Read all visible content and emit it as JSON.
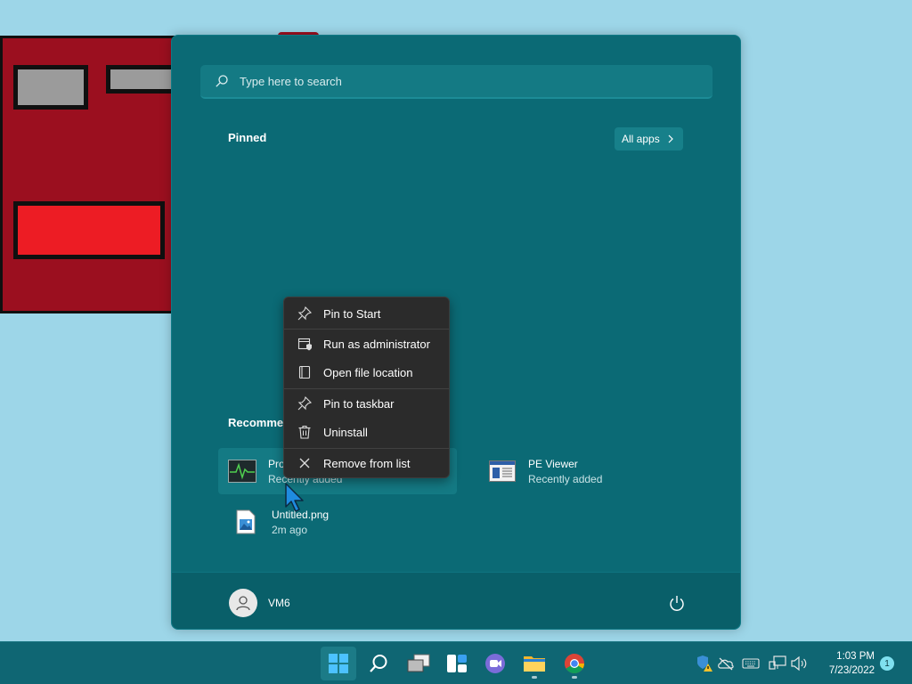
{
  "start_menu": {
    "search": {
      "placeholder": "Type here to search"
    },
    "pinned_title": "Pinned",
    "all_apps_label": "All apps",
    "recommended_title": "Recomme",
    "recommended": [
      {
        "name": "Pro",
        "subtitle": "Recently added",
        "icon": "task-manager-icon"
      },
      {
        "name": "PE Viewer",
        "subtitle": "Recently added",
        "icon": "pe-viewer-icon"
      },
      {
        "name": "Untitled.png",
        "subtitle": "2m ago",
        "icon": "image-file-icon"
      }
    ],
    "user": {
      "name": "VM6"
    }
  },
  "context_menu": {
    "items": [
      {
        "label": "Pin to Start",
        "icon": "pin-icon"
      },
      {
        "label": "Run as administrator",
        "icon": "shield-window-icon"
      },
      {
        "label": "Open file location",
        "icon": "file-location-icon"
      },
      {
        "label": "Pin to taskbar",
        "icon": "pin-icon"
      },
      {
        "label": "Uninstall",
        "icon": "trash-icon"
      },
      {
        "label": "Remove from list",
        "icon": "close-icon"
      }
    ]
  },
  "taskbar": {
    "apps": [
      "start",
      "search",
      "task-view",
      "widgets",
      "chat",
      "file-explorer",
      "chrome"
    ],
    "clock": {
      "time": "1:03 PM",
      "date": "7/23/2022"
    },
    "notification_count": "1"
  },
  "colors": {
    "start_bg": "#0b6a75",
    "taskbar_bg": "#0f6673",
    "desktop_bg": "#9dd6e8",
    "context_bg": "#2b2b2b"
  }
}
